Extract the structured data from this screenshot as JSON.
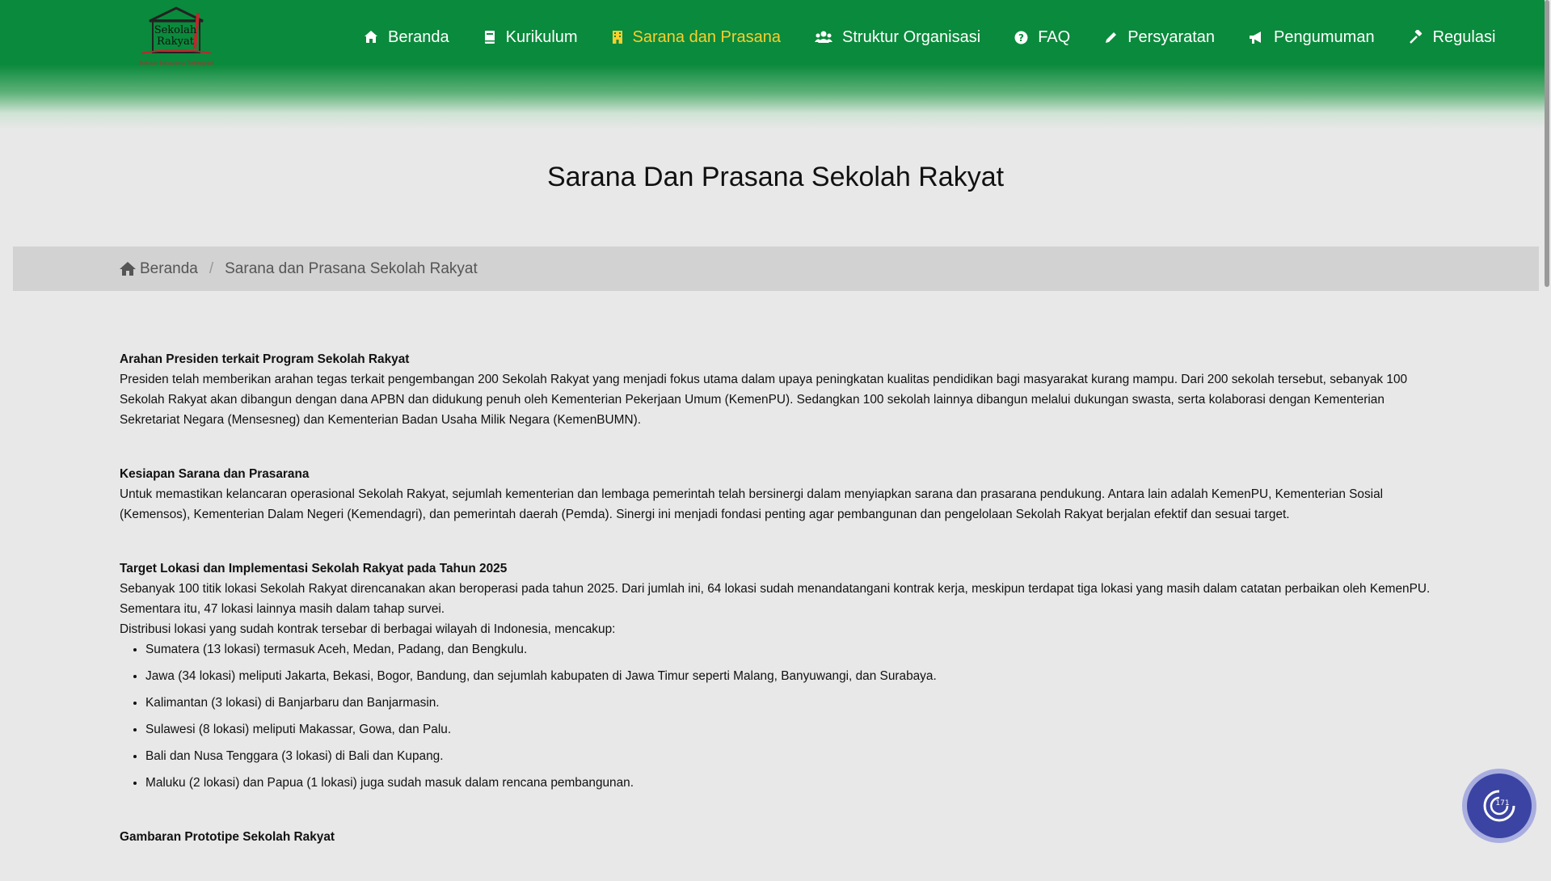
{
  "logo": {
    "line1": "Sekolah",
    "line2": "Rakyat",
    "tagline": "Sekolah Berasrama Terintegrasi"
  },
  "nav": {
    "items": [
      {
        "label": "Beranda",
        "icon": "home-icon",
        "active": false
      },
      {
        "label": "Kurikulum",
        "icon": "book-icon",
        "active": false
      },
      {
        "label": "Sarana dan Prasana",
        "icon": "building-icon",
        "active": true
      },
      {
        "label": "Struktur Organisasi",
        "icon": "users-icon",
        "active": false
      },
      {
        "label": "FAQ",
        "icon": "question-circle-icon",
        "active": false
      },
      {
        "label": "Persyaratan",
        "icon": "pencil-icon",
        "active": false
      },
      {
        "label": "Pengumuman",
        "icon": "megaphone-icon",
        "active": false
      },
      {
        "label": "Regulasi",
        "icon": "gavel-icon",
        "active": false
      }
    ]
  },
  "page": {
    "title": "Sarana Dan Prasana Sekolah Rakyat"
  },
  "breadcrumb": {
    "home": "Beranda",
    "separator": "/",
    "current": "Sarana dan Prasana Sekolah Rakyat"
  },
  "sections": [
    {
      "heading": "Arahan Presiden terkait Program Sekolah Rakyat",
      "paragraph": "Presiden telah memberikan arahan tegas terkait pengembangan 200 Sekolah Rakyat yang menjadi fokus utama dalam upaya peningkatan kualitas pendidikan bagi masyarakat kurang mampu. Dari 200 sekolah tersebut, sebanyak 100 Sekolah Rakyat akan dibangun dengan dana APBN dan didukung penuh oleh Kementerian Pekerjaan Umum (KemenPU). Sedangkan 100 sekolah lainnya dibangun melalui dukungan swasta, serta kolaborasi dengan Kementerian Sekretariat Negara (Mensesneg) dan Kementerian Badan Usaha Milik Negara (KemenBUMN)."
    },
    {
      "heading": "Kesiapan Sarana dan Prasarana",
      "paragraph": "Untuk memastikan kelancaran operasional Sekolah Rakyat, sejumlah kementerian dan lembaga pemerintah telah bersinergi dalam menyiapkan sarana dan prasarana pendukung. Antara lain adalah KemenPU, Kementerian Sosial (Kemensos), Kementerian Dalam Negeri (Kemendagri), dan pemerintah daerah (Pemda). Sinergi ini menjadi fondasi penting agar pembangunan dan pengelolaan Sekolah Rakyat berjalan efektif dan sesuai target."
    },
    {
      "heading": "Target Lokasi dan Implementasi Sekolah Rakyat pada Tahun 2025",
      "paragraph": "Sebanyak 100 titik lokasi Sekolah Rakyat direncanakan akan beroperasi pada tahun 2025. Dari jumlah ini, 64 lokasi sudah menandatangani kontrak kerja, meskipun terdapat tiga lokasi yang masih dalam catatan perbaikan oleh KemenPU. Sementara itu, 47 lokasi lainnya masih dalam tahap survei.",
      "intro": "Distribusi lokasi yang sudah kontrak tersebar di berbagai wilayah di Indonesia, mencakup:",
      "bullets": [
        "Sumatera (13 lokasi) termasuk Aceh, Medan, Padang, dan Bengkulu.",
        "Jawa (34 lokasi) meliputi Jakarta, Bekasi, Bogor, Bandung, dan sejumlah kabupaten di Jawa Timur seperti Malang, Banyuwangi, dan Surabaya.",
        "Kalimantan (3 lokasi) di Banjarbaru dan Banjarmasin.",
        "Sulawesi (8 lokasi) meliputi Makassar, Gowa, dan Palu.",
        "Bali dan Nusa Tenggara (3 lokasi) di Bali dan Kupang.",
        "Maluku (2 lokasi) dan Papua (1 lokasi) juga sudah masuk dalam rencana pembangunan."
      ]
    },
    {
      "heading": "Gambaran Prototipe Sekolah Rakyat"
    }
  ],
  "fab": {
    "icon": "accessibility-icon",
    "badge": "171"
  },
  "colors": {
    "header_green": "#0a8a3c",
    "active_nav": "#f8cf2e",
    "fab_blue": "#3b44a3"
  }
}
